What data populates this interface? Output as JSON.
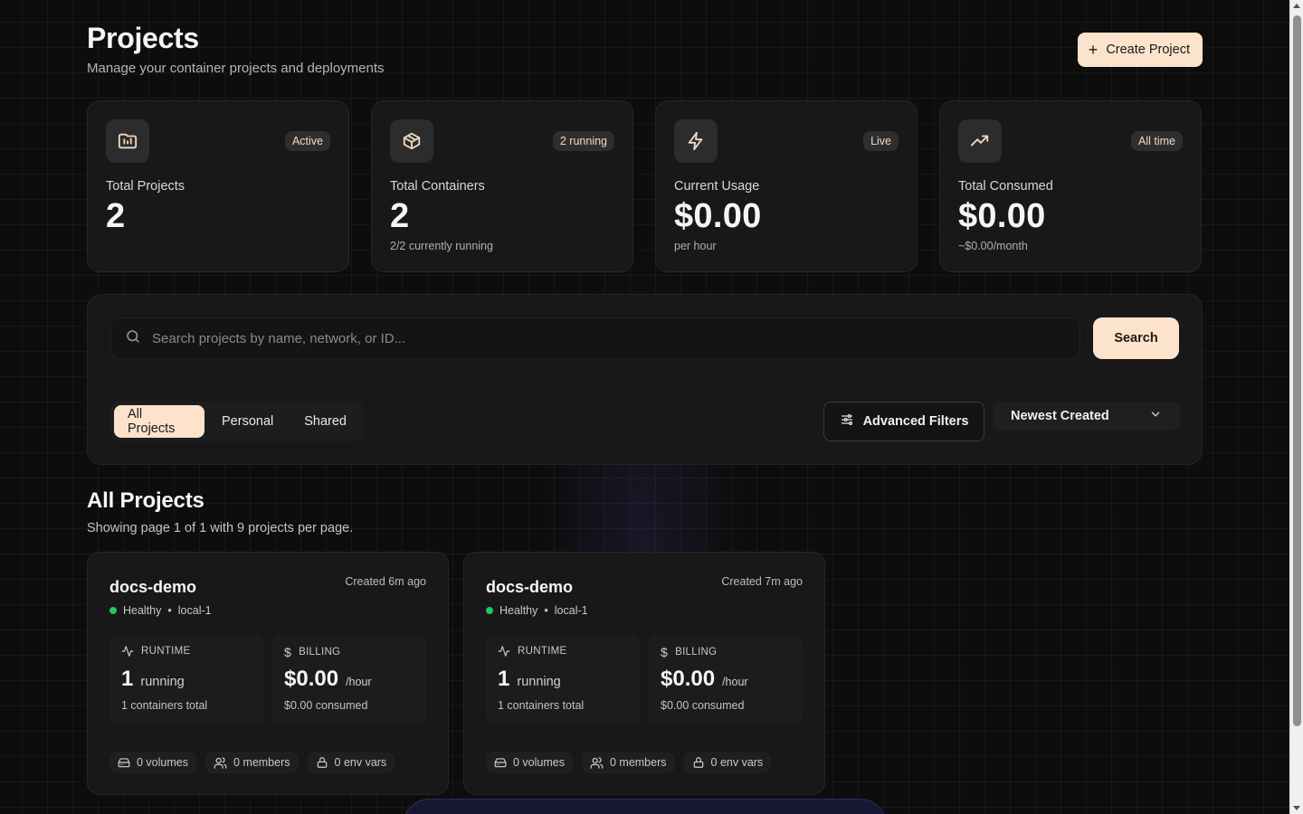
{
  "header": {
    "title": "Projects",
    "subtitle": "Manage your container projects and deployments",
    "create_label": "Create Project"
  },
  "stats": [
    {
      "icon": "folder-chart-icon",
      "badge": "Active",
      "label": "Total Projects",
      "value": "2",
      "sub": ""
    },
    {
      "icon": "box-icon",
      "badge": "2 running",
      "label": "Total Containers",
      "value": "2",
      "sub": "2/2 currently running"
    },
    {
      "icon": "lightning-icon",
      "badge": "Live",
      "label": "Current Usage",
      "value": "$0.00",
      "sub": "per hour"
    },
    {
      "icon": "trending-up-icon",
      "badge": "All time",
      "label": "Total Consumed",
      "value": "$0.00",
      "sub": "~$0.00/month"
    }
  ],
  "search": {
    "placeholder": "Search projects by name, network, or ID...",
    "value": "",
    "button_label": "Search"
  },
  "tabs": [
    "All Projects",
    "Personal",
    "Shared"
  ],
  "active_tab": "All Projects",
  "advanced_filters_label": "Advanced Filters",
  "sort": {
    "selected": "Newest Created"
  },
  "section": {
    "title": "All Projects",
    "subtitle": "Showing page 1 of 1 with 9 projects per page."
  },
  "projects": [
    {
      "name": "docs-demo",
      "created": "Created 6m ago",
      "status": "Healthy",
      "node": "local-1",
      "runtime_label": "RUNTIME",
      "running_count": "1",
      "running_label": "running",
      "containers_total": "1 containers total",
      "billing_label": "BILLING",
      "billing_value": "$0.00",
      "billing_unit": "/hour",
      "billing_consumed": "$0.00 consumed",
      "volumes": "0 volumes",
      "members": "0 members",
      "env_vars": "0 env vars"
    },
    {
      "name": "docs-demo",
      "created": "Created 7m ago",
      "status": "Healthy",
      "node": "local-1",
      "runtime_label": "RUNTIME",
      "running_count": "1",
      "running_label": "running",
      "containers_total": "1 containers total",
      "billing_label": "BILLING",
      "billing_value": "$0.00",
      "billing_unit": "/hour",
      "billing_consumed": "$0.00 consumed",
      "volumes": "0 volumes",
      "members": "0 members",
      "env_vars": "0 env vars"
    }
  ],
  "colors": {
    "accent": "#fde3cc",
    "healthy": "#22c55e",
    "background": "#0d0d0d",
    "card": "#181818"
  }
}
